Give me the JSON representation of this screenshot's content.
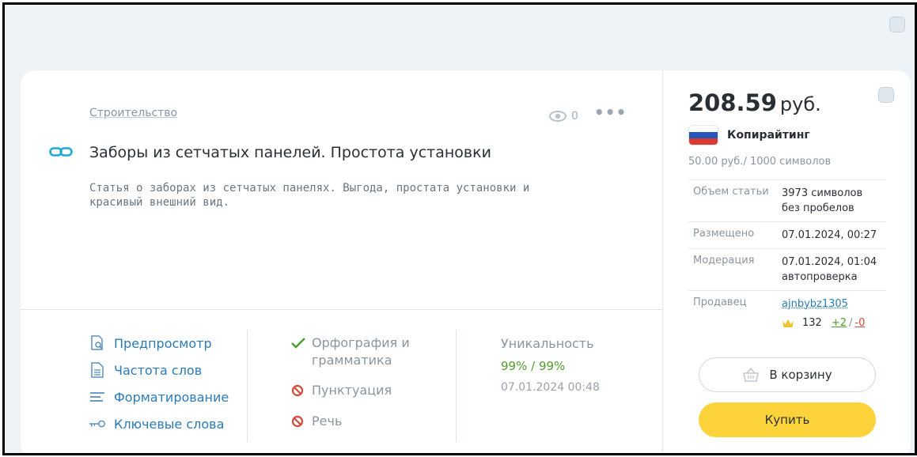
{
  "article": {
    "category": "Строительство",
    "views": "0",
    "title": "Заборы из сетчатых панелей. Простота установки",
    "description": "Статья о заборах из сетчатых панелях. Выгода, простата установки и красивый внешний вид."
  },
  "tools": [
    {
      "label": "Предпросмотр",
      "icon": "preview-icon"
    },
    {
      "label": "Частота слов",
      "icon": "document-icon"
    },
    {
      "label": "Форматирование",
      "icon": "format-icon"
    },
    {
      "label": "Ключевые слова",
      "icon": "key-icon"
    }
  ],
  "checks": [
    {
      "label": "Орфография и грамматика",
      "status": "ok"
    },
    {
      "label": "Пунктуация",
      "status": "blocked"
    },
    {
      "label": "Речь",
      "status": "blocked"
    }
  ],
  "uniqueness": {
    "label": "Уникальность",
    "value1": "99%",
    "value2": "99%",
    "date": "07.01.2024 00:48"
  },
  "sidebar": {
    "price": "208.59",
    "currency": "руб.",
    "language": "Копирайтинг",
    "rate": "50.00 руб./ 1000 символов",
    "rows": {
      "volume_k": "Объем статьи",
      "volume_v1": "3973 символов",
      "volume_v2": "без пробелов",
      "placed_k": "Размещено",
      "placed_v": "07.01.2024, 00:27",
      "moder_k": "Модерация",
      "moder_v1": "07.01.2024, 01:04",
      "moder_v2": "автопроверка",
      "seller_k": "Продавец",
      "seller_v": "ajnbybz1305",
      "rating": "132",
      "plus": "+2",
      "minus": "-0"
    },
    "cart_label": "В корзину",
    "buy_label": "Купить"
  },
  "colors": {
    "accent_link": "#2b7bb9",
    "ok_green": "#4e9d2d",
    "buy_yellow": "#fdd33c",
    "error_red": "#d64a3a"
  }
}
